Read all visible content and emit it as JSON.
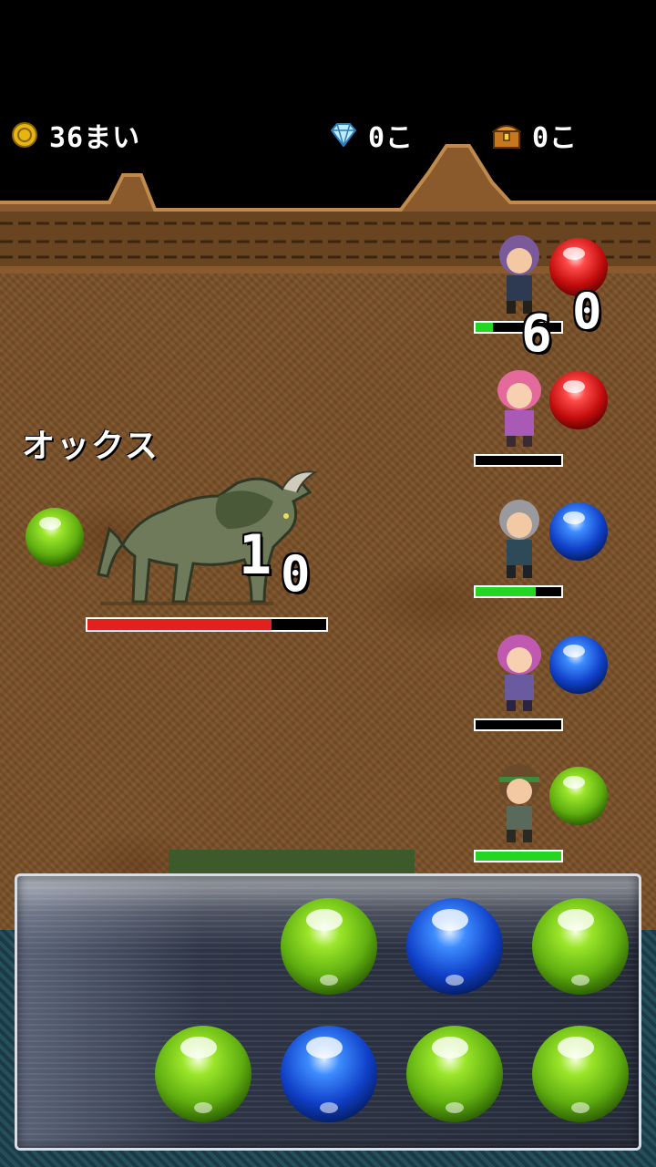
{
  "hud": {
    "coins_label": "36まい",
    "gems_label": "0こ",
    "chests_label": "0こ"
  },
  "enemy": {
    "name": "オックス",
    "orb_color": "green",
    "hp_fraction": 0.77,
    "damage_digits": [
      "1",
      "0"
    ]
  },
  "party_damage_digits": [
    "6",
    "0"
  ],
  "party": [
    {
      "name": "hero-1",
      "orb_color": "red",
      "hp_fraction": 0.2
    },
    {
      "name": "hero-2",
      "orb_color": "red",
      "hp_fraction": 0.0
    },
    {
      "name": "hero-3",
      "orb_color": "blue",
      "hp_fraction": 0.7
    },
    {
      "name": "hero-4",
      "orb_color": "blue",
      "hp_fraction": 0.0
    },
    {
      "name": "hero-5",
      "orb_color": "green",
      "hp_fraction": 1.0
    }
  ],
  "board": [
    [
      "empty",
      "empty",
      "green",
      "blue",
      "green"
    ],
    [
      "empty",
      "green",
      "blue",
      "green",
      "green"
    ]
  ],
  "colors": {
    "hp_enemy": "#e12020",
    "hp_party": "#22d622",
    "ground": "#7a5128",
    "panel_border": "#d8dde6"
  },
  "icons": {
    "coin": "gold-coin-icon",
    "gem": "diamond-icon",
    "chest": "treasure-chest-icon"
  }
}
